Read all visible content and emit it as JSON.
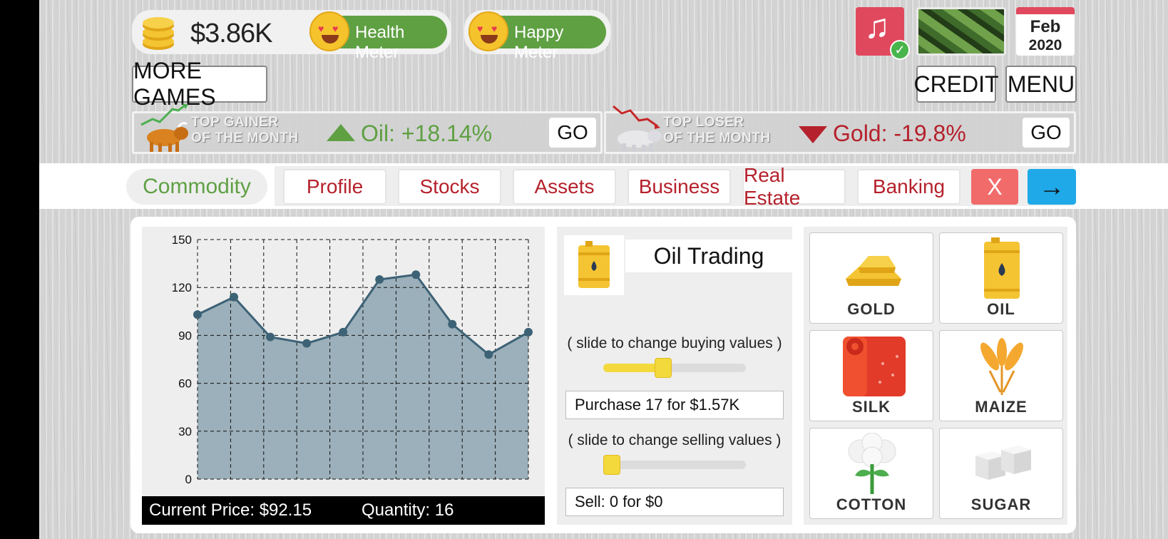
{
  "hud": {
    "money": "$3.86K",
    "health_meter": "Health Meter",
    "happy_meter": "Happy Meter",
    "date_month": "Feb",
    "date_year": "2020"
  },
  "buttons": {
    "more_games": "MORE GAMES",
    "credit": "CREDIT",
    "menu": "MENU"
  },
  "tickers": {
    "gainer": {
      "title_line1": "TOP GAINER",
      "title_line2": "OF THE MONTH",
      "value": "Oil: +18.14%",
      "go": "GO",
      "color": "#5fa043"
    },
    "loser": {
      "title_line1": "TOP LOSER",
      "title_line2": "OF THE MONTH",
      "value": "Gold: -19.8%",
      "go": "GO",
      "color": "#b5212c"
    }
  },
  "tabs": {
    "active": "Commodity",
    "items": [
      "Profile",
      "Stocks",
      "Assets",
      "Business",
      "Real Estate",
      "Banking"
    ],
    "close": "X",
    "next": "→"
  },
  "chart_data": {
    "type": "area",
    "x": [
      1,
      2,
      3,
      4,
      5,
      6,
      7,
      8,
      9,
      10,
      11
    ],
    "values": [
      103,
      114,
      89,
      85,
      92,
      125,
      128,
      97,
      78,
      92
    ],
    "point_x": [
      0,
      1.1,
      2.2,
      3.3,
      4.4,
      5.5,
      6.6,
      7.7,
      8.8,
      10
    ],
    "yticks": [
      "150",
      "120",
      "90",
      "60",
      "30",
      "0"
    ],
    "ylim": [
      0,
      150
    ],
    "grid": true,
    "colors": {
      "fill": "#9bb0ba",
      "line": "#3d6276"
    }
  },
  "chart_footer": {
    "current_price": "Current Price: $92.15",
    "quantity": "Quantity: 16"
  },
  "trade": {
    "title": "Oil Trading",
    "buy_hint": "( slide to change buying values )",
    "buy_level": 0.42,
    "purchase_text": "Purchase 17 for $1.57K",
    "sell_hint": "( slide to change selling values )",
    "sell_level": 0.0,
    "sell_text": "Sell: 0 for $0"
  },
  "commodities": [
    {
      "label": "GOLD",
      "icon": "gold-bars-icon"
    },
    {
      "label": "OIL",
      "icon": "oil-barrel-icon"
    },
    {
      "label": "SILK",
      "icon": "silk-roll-icon"
    },
    {
      "label": "MAIZE",
      "icon": "wheat-icon"
    },
    {
      "label": "COTTON",
      "icon": "cotton-icon"
    },
    {
      "label": "SUGAR",
      "icon": "sugar-cubes-icon"
    }
  ]
}
